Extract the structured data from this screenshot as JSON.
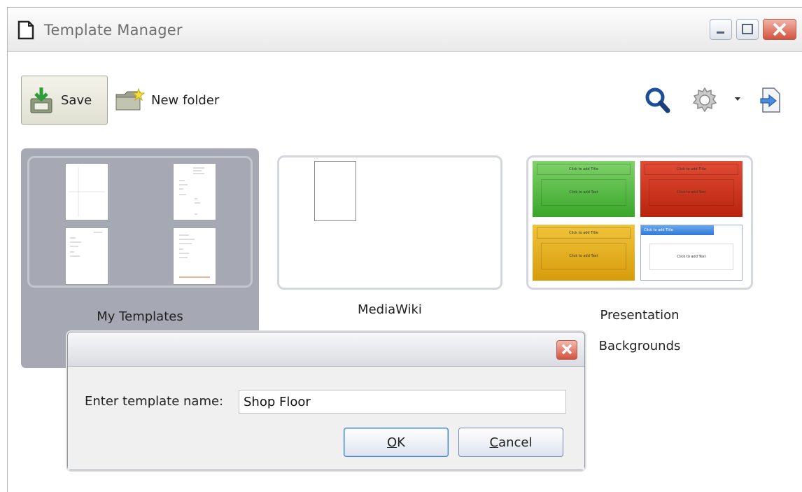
{
  "window": {
    "title": "Template Manager"
  },
  "toolbar": {
    "save_label": "Save",
    "new_folder_label": "New folder",
    "right_icons": [
      "search-icon",
      "gear-icon",
      "import-icon"
    ]
  },
  "folders": [
    {
      "label": "My Templates",
      "selected": true
    },
    {
      "label": "MediaWiki",
      "selected": false
    },
    {
      "label_line1": "Presentation",
      "label_line2": "Backgrounds",
      "selected": false
    }
  ],
  "slide_thumbs": {
    "title_text": "Click to add Title",
    "body_text": "Click to add Text",
    "colors": [
      "#4cbf3a",
      "#d5351f",
      "#e5b318",
      "#ffffff"
    ]
  },
  "dialog": {
    "prompt": "Enter template name:",
    "input_value": "Shop Floor",
    "ok_prefix": "",
    "ok_underlined": "O",
    "ok_rest": "K",
    "cancel_underlined": "C",
    "cancel_rest": "ancel"
  }
}
